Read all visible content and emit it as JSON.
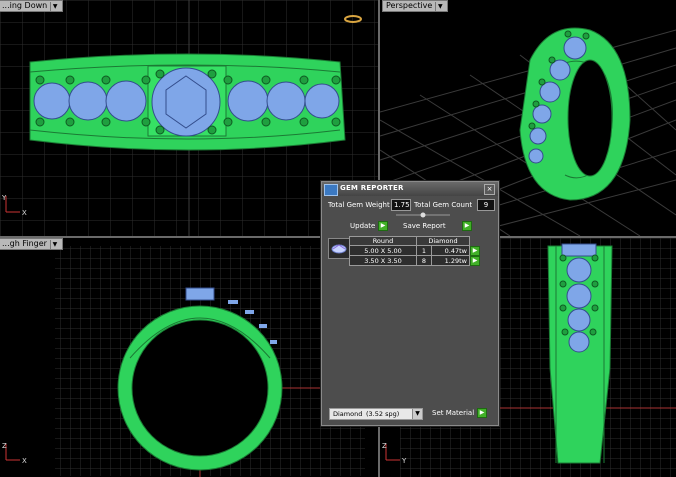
{
  "viewports": {
    "top_left": {
      "label": "...ing Down",
      "axis": [
        "Y",
        "X"
      ]
    },
    "top_right": {
      "label": "Perspective"
    },
    "bottom_left": {
      "label": "...gh Finger",
      "axis": [
        "Z",
        "X"
      ]
    },
    "bottom_right": {
      "label": "",
      "axis": [
        "Z",
        "Y"
      ]
    }
  },
  "dialog": {
    "title": "GEM REPORTER",
    "close": "×",
    "total_gem_weight_label": "Total Gem Weight",
    "total_gem_weight_value": "1.75",
    "total_gem_count_label": "Total Gem Count",
    "total_gem_count_value": "9",
    "update_label": "Update",
    "save_report_label": "Save Report",
    "table": {
      "headers": [
        "Round",
        "Diamond"
      ],
      "rows": [
        {
          "size": "5.00 X 5.00",
          "count": "1",
          "weight": "0.47tw"
        },
        {
          "size": "3.50 X 3.50",
          "count": "8",
          "weight": "1.29tw"
        }
      ]
    },
    "material_select": {
      "value": "Diamond",
      "detail": "(3.52 spg)"
    },
    "set_material_label": "Set Material"
  },
  "colors": {
    "metal": "#2fd35c",
    "gem": "#7fa6e8",
    "grid": "#2e2e2e",
    "accent_button": "#42b028"
  }
}
